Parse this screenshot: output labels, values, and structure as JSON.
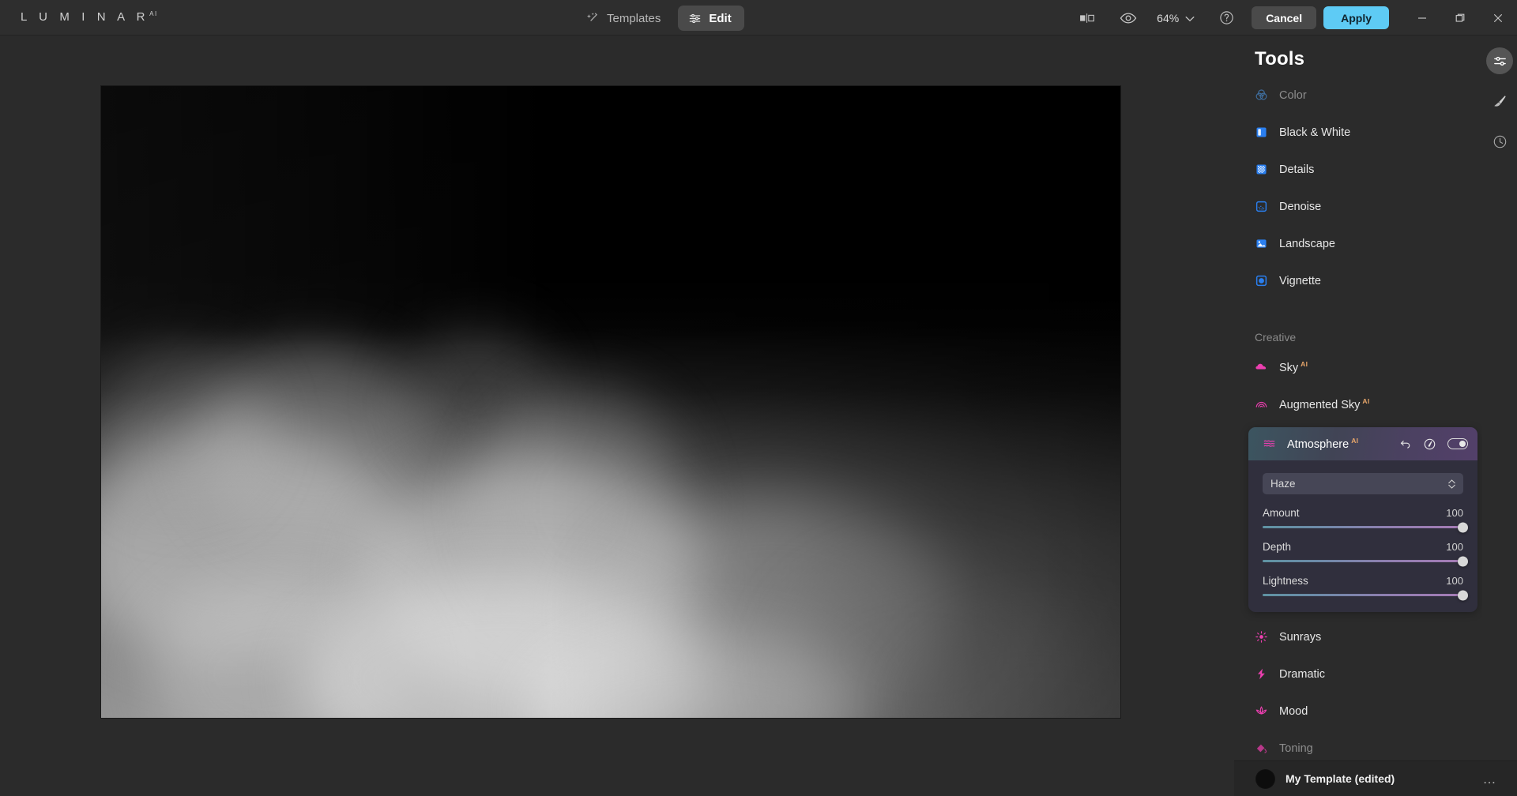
{
  "app": {
    "brand": "L U M I N A R",
    "brand_sup": "AI",
    "accent_apply": "#5ecbf5",
    "accent_tool_blue": "#2a7ff0",
    "accent_creative_pink": "#ec3fb0",
    "accent_ai_badge": "#e8a66a"
  },
  "header": {
    "tabs": [
      {
        "label": "Templates",
        "icon": "magic-wand-icon",
        "active": false
      },
      {
        "label": "Edit",
        "icon": "sliders-icon",
        "active": true
      }
    ],
    "compare_icon": "compare-split-icon",
    "preview_icon": "eye-icon",
    "zoom_level": "64%",
    "zoom_chevron_icon": "chevron-down-icon",
    "help_icon": "help-circle-icon",
    "cancel_label": "Cancel",
    "apply_label": "Apply",
    "window": {
      "minimize_icon": "minimize-icon",
      "maximize_icon": "maximize-icon",
      "close_icon": "close-icon"
    }
  },
  "panel": {
    "title": "Tools",
    "essentials_items": [
      {
        "label": "Color",
        "icon": "color-circles-icon",
        "dimmed": true
      },
      {
        "label": "Black & White",
        "icon": "black-white-icon",
        "dimmed": false
      },
      {
        "label": "Details",
        "icon": "details-grid-icon",
        "dimmed": false
      },
      {
        "label": "Denoise",
        "icon": "denoise-icon",
        "dimmed": false
      },
      {
        "label": "Landscape",
        "icon": "landscape-icon",
        "dimmed": false
      },
      {
        "label": "Vignette",
        "icon": "vignette-icon",
        "dimmed": false
      }
    ],
    "creative_section": "Creative",
    "creative_items_before": [
      {
        "label": "Sky",
        "ai": "AI",
        "icon": "cloud-icon"
      },
      {
        "label": "Augmented Sky",
        "ai": "AI",
        "icon": "arc-rays-icon"
      }
    ],
    "creative_items_after": [
      {
        "label": "Sunrays",
        "ai": "",
        "icon": "sun-icon"
      },
      {
        "label": "Dramatic",
        "ai": "",
        "icon": "lightning-bolt-icon"
      },
      {
        "label": "Mood",
        "ai": "",
        "icon": "lotus-icon"
      },
      {
        "label": "Toning",
        "ai": "",
        "icon": "paint-bucket-icon"
      }
    ],
    "atmosphere": {
      "label": "Atmosphere",
      "ai": "AI",
      "icon": "waves-icon",
      "reset_icon": "undo-arrow-icon",
      "mask_icon": "mask-brush-icon",
      "toggle_icon": "toggle-on-icon",
      "toggle_state": "on",
      "preset": {
        "label": "Haze",
        "arrows_icon": "updown-chevrons-icon"
      },
      "sliders": [
        {
          "label": "Amount",
          "value": "100",
          "percent": 100
        },
        {
          "label": "Depth",
          "value": "100",
          "percent": 100
        },
        {
          "label": "Lightness",
          "value": "100",
          "percent": 100
        }
      ]
    }
  },
  "rail": [
    {
      "icon": "adjust-sliders-icon",
      "active": true
    },
    {
      "icon": "brush-icon",
      "active": false
    },
    {
      "icon": "history-clock-icon",
      "active": false
    }
  ],
  "footer": {
    "thumbnail": "template-thumbnail",
    "template_name": "My Template (edited)",
    "menu_icon": "ellipsis-icon"
  },
  "canvas": {
    "image_description": "grayscale fog and smoke over black background"
  }
}
